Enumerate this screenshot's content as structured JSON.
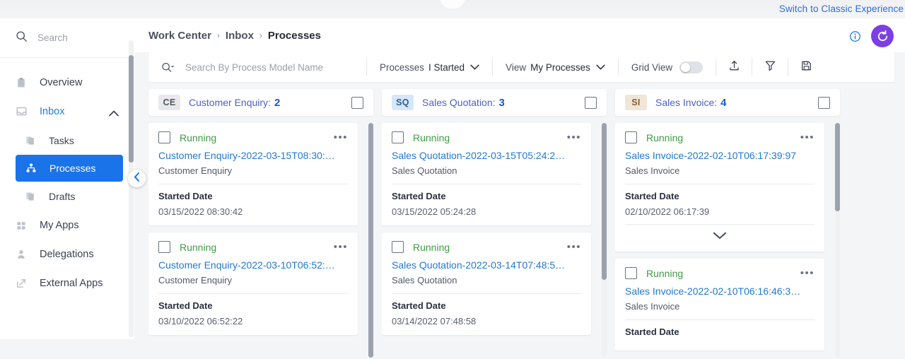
{
  "top": {
    "switch_label": "Switch to Classic Experience"
  },
  "sidebar": {
    "search_placeholder": "Search",
    "items": [
      {
        "label": "Overview",
        "icon": "clipboard-icon",
        "level": "top",
        "state": "normal"
      },
      {
        "label": "Inbox",
        "icon": "inbox-icon",
        "level": "top",
        "state": "expanded"
      },
      {
        "label": "Tasks",
        "icon": "documents-icon",
        "level": "sub",
        "state": "normal"
      },
      {
        "label": "Processes",
        "icon": "hierarchy-icon",
        "level": "sub",
        "state": "selected"
      },
      {
        "label": "Drafts",
        "icon": "documents-icon",
        "level": "sub",
        "state": "normal"
      },
      {
        "label": "My Apps",
        "icon": "grid-icon",
        "level": "top",
        "state": "normal"
      },
      {
        "label": "Delegations",
        "icon": "person-icon",
        "level": "top",
        "state": "normal"
      },
      {
        "label": "External Apps",
        "icon": "external-link-icon",
        "level": "top",
        "state": "normal"
      }
    ]
  },
  "header": {
    "breadcrumb": [
      "Work Center",
      "Inbox",
      "Processes"
    ],
    "separator": "›",
    "info_icon": "info-icon",
    "refresh_icon": "refresh-icon"
  },
  "toolbar": {
    "search_placeholder": "Search By Process Model Name",
    "search_icon": "search-dropdown-icon",
    "processes_label": "Processes",
    "processes_value": "I Started",
    "view_label": "View",
    "view_value": "My Processes",
    "grid_view_label": "Grid View",
    "grid_view_on": false,
    "icons": [
      "upload-icon",
      "filter-icon",
      "save-icon"
    ]
  },
  "columns": [
    {
      "badge": "CE",
      "badge_bg": "#e8e9ea",
      "badge_fg": "#515766",
      "title": "Customer Enquiry:",
      "count": "2",
      "scroll_thumb_top": 0,
      "scroll_thumb_height": 332,
      "cards": [
        {
          "status": "Running",
          "link": "Customer Enquiry-2022-03-15T08:30:…",
          "subtitle": "Customer Enquiry",
          "field_label": "Started Date",
          "field_value": "03/15/2022 08:30:42",
          "expandable": false
        },
        {
          "status": "Running",
          "link": "Customer Enquiry-2022-03-10T06:52:…",
          "subtitle": "Customer Enquiry",
          "field_label": "Started Date",
          "field_value": "03/10/2022 06:52:22",
          "expandable": false
        }
      ]
    },
    {
      "badge": "SQ",
      "badge_bg": "#d6e7fa",
      "badge_fg": "#2b5e9e",
      "title": "Sales Quotation:",
      "count": "3",
      "scroll_thumb_top": 0,
      "scroll_thumb_height": 222,
      "cards": [
        {
          "status": "Running",
          "link": "Sales Quotation-2022-03-15T05:24:2…",
          "subtitle": "Sales Quotation",
          "field_label": "Started Date",
          "field_value": "03/15/2022 05:24:28",
          "expandable": false
        },
        {
          "status": "Running",
          "link": "Sales Quotation-2022-03-14T07:48:5…",
          "subtitle": "Sales Quotation",
          "field_label": "Started Date",
          "field_value": "03/14/2022 07:48:58",
          "expandable": false
        }
      ]
    },
    {
      "badge": "SI",
      "badge_bg": "#f0e6d8",
      "badge_fg": "#8a5a2b",
      "title": "Sales Invoice:",
      "count": "4",
      "scroll_thumb_top": 0,
      "scroll_thumb_height": 125,
      "cards": [
        {
          "status": "Running",
          "link": "Sales Invoice-2022-02-10T06:17:39:97",
          "subtitle": "Sales Invoice",
          "field_label": "Started Date",
          "field_value": "02/10/2022 06:17:39",
          "expandable": true
        },
        {
          "status": "Running",
          "link": "Sales Invoice-2022-02-10T06:16:46:3…",
          "subtitle": "Sales Invoice",
          "field_label": "Started Date",
          "field_value": "",
          "expandable": false
        }
      ]
    }
  ]
}
